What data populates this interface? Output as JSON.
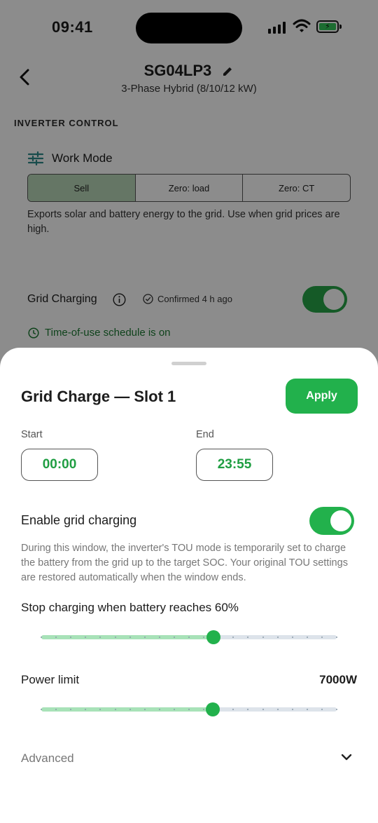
{
  "status": {
    "time": "09:41"
  },
  "header": {
    "title": "SG04LP3",
    "subtitle": "3-Phase Hybrid (8/10/12 kW)"
  },
  "inverter": {
    "section_label": "INVERTER CONTROL",
    "work_mode_label": "Work Mode",
    "modes": [
      "Sell",
      "Zero: load",
      "Zero: CT"
    ],
    "selected_mode": "Sell",
    "mode_description": "Exports solar and battery energy to the grid. Use when grid prices are high."
  },
  "grid_charging": {
    "label": "Grid Charging",
    "confirmed": "Confirmed 4 h ago",
    "enabled": true,
    "tou_status": "Time-of-use schedule is on"
  },
  "sheet": {
    "title": "Grid Charge — Slot 1",
    "apply_label": "Apply",
    "start_label": "Start",
    "start_value": "00:00",
    "end_label": "End",
    "end_value": "23:55",
    "enable_label": "Enable grid charging",
    "enable_on": true,
    "description": "During this window, the inverter's TOU mode is temporarily set to charge the battery from the grid up to the target SOC. Your original TOU settings are restored automatically when the window ends.",
    "stop_label": "Stop charging when battery reaches 60%",
    "stop_percent": 60,
    "power_label": "Power limit",
    "power_value": "7000W",
    "power_fraction": 0.58,
    "advanced_label": "Advanced"
  },
  "colors": {
    "accent": "#22b14c",
    "accent_light": "#a8e2b8",
    "track": "#dde3ea"
  }
}
